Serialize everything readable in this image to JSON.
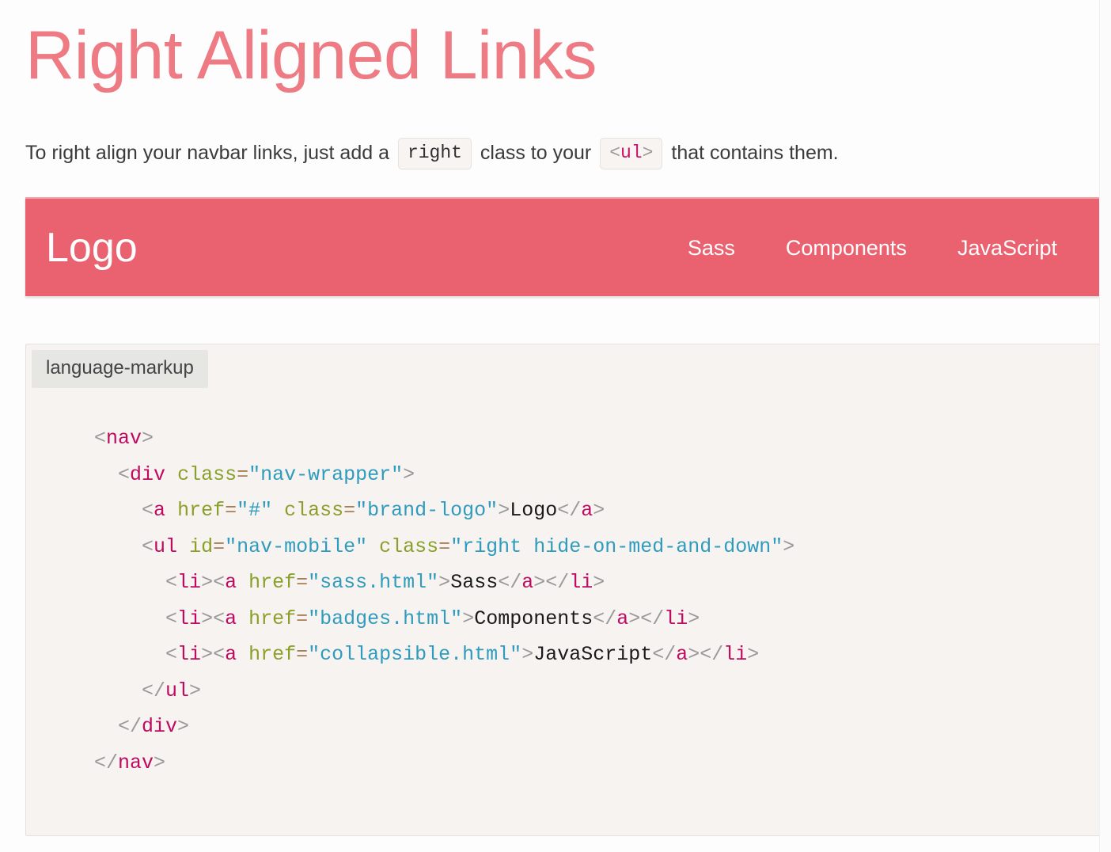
{
  "page": {
    "title": "Right Aligned Links"
  },
  "intro": {
    "part1": "To right align your navbar links, just add a",
    "code1": "right",
    "part2": "class to your",
    "code2_open": "<",
    "code2_tag": "ul",
    "code2_close": ">",
    "part3": "that contains them."
  },
  "navbar": {
    "brand": "Logo",
    "background_color": "#ea626f",
    "text_color": "#ffffff",
    "links": [
      {
        "label": "Sass"
      },
      {
        "label": "Components"
      },
      {
        "label": "JavaScript"
      }
    ]
  },
  "code_block": {
    "language_label": "language-markup",
    "lines": [
      {
        "indent": "  ",
        "tokens": [
          {
            "t": "punc",
            "v": "<"
          },
          {
            "t": "tag",
            "v": "nav"
          },
          {
            "t": "punc",
            "v": ">"
          }
        ]
      },
      {
        "indent": "    ",
        "tokens": [
          {
            "t": "punc",
            "v": "<"
          },
          {
            "t": "tag",
            "v": "div"
          },
          {
            "t": "plain",
            "v": " "
          },
          {
            "t": "attr",
            "v": "class"
          },
          {
            "t": "eq",
            "v": "="
          },
          {
            "t": "str",
            "v": "\"nav-wrapper\""
          },
          {
            "t": "punc",
            "v": ">"
          }
        ]
      },
      {
        "indent": "      ",
        "tokens": [
          {
            "t": "punc",
            "v": "<"
          },
          {
            "t": "tag",
            "v": "a"
          },
          {
            "t": "plain",
            "v": " "
          },
          {
            "t": "attr",
            "v": "href"
          },
          {
            "t": "eq",
            "v": "="
          },
          {
            "t": "str",
            "v": "\"#\""
          },
          {
            "t": "plain",
            "v": " "
          },
          {
            "t": "attr",
            "v": "class"
          },
          {
            "t": "eq",
            "v": "="
          },
          {
            "t": "str",
            "v": "\"brand-logo\""
          },
          {
            "t": "punc",
            "v": ">"
          },
          {
            "t": "text",
            "v": "Logo"
          },
          {
            "t": "punc",
            "v": "</"
          },
          {
            "t": "tag",
            "v": "a"
          },
          {
            "t": "punc",
            "v": ">"
          }
        ]
      },
      {
        "indent": "      ",
        "tokens": [
          {
            "t": "punc",
            "v": "<"
          },
          {
            "t": "tag",
            "v": "ul"
          },
          {
            "t": "plain",
            "v": " "
          },
          {
            "t": "attr",
            "v": "id"
          },
          {
            "t": "eq",
            "v": "="
          },
          {
            "t": "str",
            "v": "\"nav-mobile\""
          },
          {
            "t": "plain",
            "v": " "
          },
          {
            "t": "attr",
            "v": "class"
          },
          {
            "t": "eq",
            "v": "="
          },
          {
            "t": "str",
            "v": "\"right hide-on-med-and-down\""
          },
          {
            "t": "punc",
            "v": ">"
          }
        ]
      },
      {
        "indent": "        ",
        "tokens": [
          {
            "t": "punc",
            "v": "<"
          },
          {
            "t": "tag",
            "v": "li"
          },
          {
            "t": "punc",
            "v": "><"
          },
          {
            "t": "tag",
            "v": "a"
          },
          {
            "t": "plain",
            "v": " "
          },
          {
            "t": "attr",
            "v": "href"
          },
          {
            "t": "eq",
            "v": "="
          },
          {
            "t": "str",
            "v": "\"sass.html\""
          },
          {
            "t": "punc",
            "v": ">"
          },
          {
            "t": "text",
            "v": "Sass"
          },
          {
            "t": "punc",
            "v": "</"
          },
          {
            "t": "tag",
            "v": "a"
          },
          {
            "t": "punc",
            "v": "></"
          },
          {
            "t": "tag",
            "v": "li"
          },
          {
            "t": "punc",
            "v": ">"
          }
        ]
      },
      {
        "indent": "        ",
        "tokens": [
          {
            "t": "punc",
            "v": "<"
          },
          {
            "t": "tag",
            "v": "li"
          },
          {
            "t": "punc",
            "v": "><"
          },
          {
            "t": "tag",
            "v": "a"
          },
          {
            "t": "plain",
            "v": " "
          },
          {
            "t": "attr",
            "v": "href"
          },
          {
            "t": "eq",
            "v": "="
          },
          {
            "t": "str",
            "v": "\"badges.html\""
          },
          {
            "t": "punc",
            "v": ">"
          },
          {
            "t": "text",
            "v": "Components"
          },
          {
            "t": "punc",
            "v": "</"
          },
          {
            "t": "tag",
            "v": "a"
          },
          {
            "t": "punc",
            "v": "></"
          },
          {
            "t": "tag",
            "v": "li"
          },
          {
            "t": "punc",
            "v": ">"
          }
        ]
      },
      {
        "indent": "        ",
        "tokens": [
          {
            "t": "punc",
            "v": "<"
          },
          {
            "t": "tag",
            "v": "li"
          },
          {
            "t": "punc",
            "v": "><"
          },
          {
            "t": "tag",
            "v": "a"
          },
          {
            "t": "plain",
            "v": " "
          },
          {
            "t": "attr",
            "v": "href"
          },
          {
            "t": "eq",
            "v": "="
          },
          {
            "t": "str",
            "v": "\"collapsible.html\""
          },
          {
            "t": "punc",
            "v": ">"
          },
          {
            "t": "text",
            "v": "JavaScript"
          },
          {
            "t": "punc",
            "v": "</"
          },
          {
            "t": "tag",
            "v": "a"
          },
          {
            "t": "punc",
            "v": "></"
          },
          {
            "t": "tag",
            "v": "li"
          },
          {
            "t": "punc",
            "v": ">"
          }
        ]
      },
      {
        "indent": "      ",
        "tokens": [
          {
            "t": "punc",
            "v": "</"
          },
          {
            "t": "tag",
            "v": "ul"
          },
          {
            "t": "punc",
            "v": ">"
          }
        ]
      },
      {
        "indent": "    ",
        "tokens": [
          {
            "t": "punc",
            "v": "</"
          },
          {
            "t": "tag",
            "v": "div"
          },
          {
            "t": "punc",
            "v": ">"
          }
        ]
      },
      {
        "indent": "  ",
        "tokens": [
          {
            "t": "punc",
            "v": "</"
          },
          {
            "t": "tag",
            "v": "nav"
          },
          {
            "t": "punc",
            "v": ">"
          }
        ]
      }
    ]
  }
}
